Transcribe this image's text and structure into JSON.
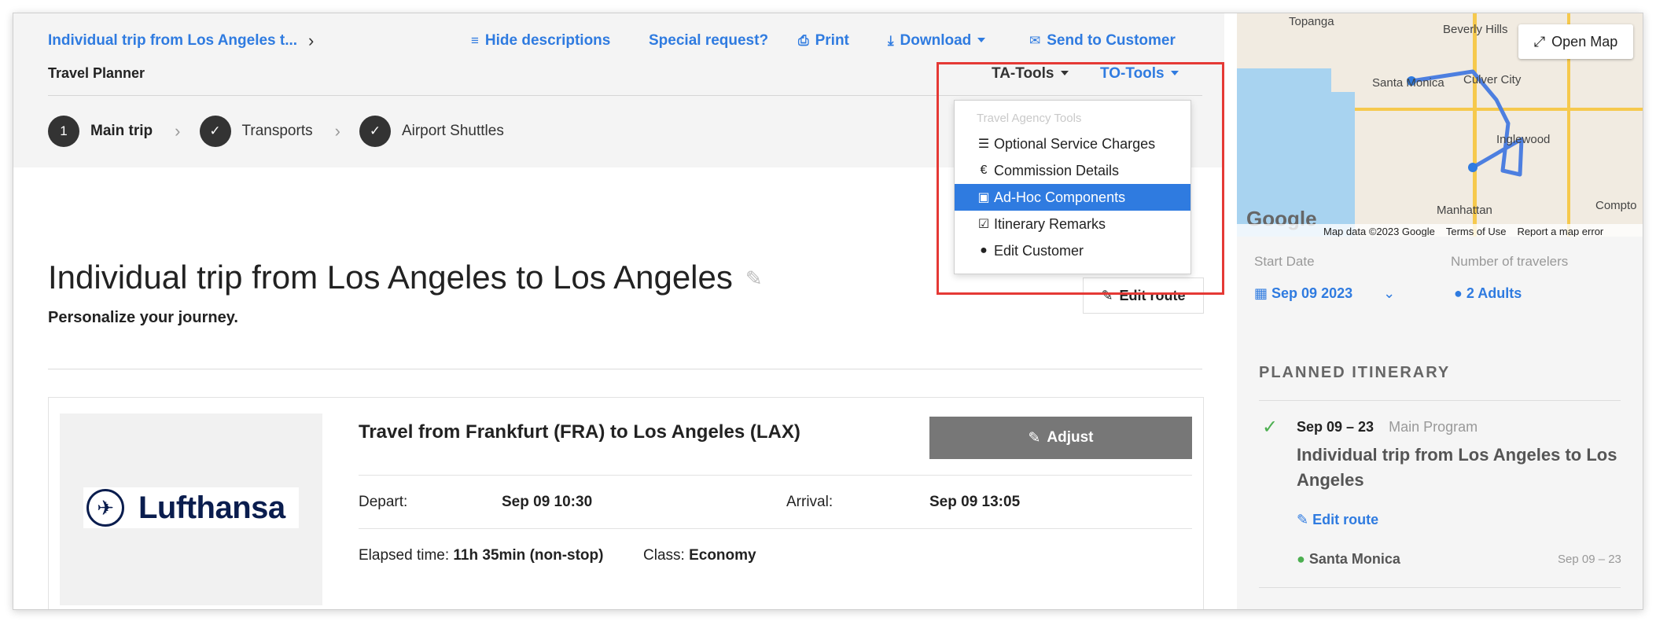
{
  "header": {
    "breadcrumb": "Individual trip from Los Angeles t...",
    "section": "Travel Planner",
    "actions": {
      "hide_descriptions": "Hide descriptions",
      "special_request": "Special request?",
      "print": "Print",
      "download": "Download",
      "send_to_customer": "Send to Customer"
    },
    "ta_tools": "TA-Tools",
    "to_tools": "TO-Tools"
  },
  "steps": [
    {
      "number": "1",
      "label": "Main trip"
    },
    {
      "label": "Transports"
    },
    {
      "label": "Airport Shuttles"
    }
  ],
  "dropdown": {
    "heading": "Travel Agency Tools",
    "items": [
      {
        "label": "Optional Service Charges",
        "icon": "list-icon"
      },
      {
        "label": "Commission Details",
        "icon": "euro-icon"
      },
      {
        "label": "Ad-Hoc Components",
        "icon": "briefcase-icon"
      },
      {
        "label": "Itinerary Remarks",
        "icon": "edit-box-icon"
      },
      {
        "label": "Edit Customer",
        "icon": "user-icon"
      }
    ],
    "active_index": 2
  },
  "trip": {
    "title": "Individual trip from Los Angeles to Los Angeles",
    "subtitle": "Personalize your journey.",
    "edit_route": "Edit route"
  },
  "flight": {
    "logo_text": "Lufthansa",
    "title": "Travel from Frankfurt (FRA) to Los Angeles (LAX)",
    "adjust": "Adjust",
    "depart_label": "Depart:",
    "depart_value": "Sep 09 10:30",
    "arrival_label": "Arrival:",
    "arrival_value": "Sep 09 13:05",
    "elapsed_label": "Elapsed time:",
    "elapsed_value": "11h 35min (non-stop)",
    "class_label": "Class:",
    "class_value": "Economy"
  },
  "map": {
    "open_map": "Open Map",
    "labels": [
      "Topanga",
      "Beverly Hills",
      "Santa Monica",
      "Culver City",
      "Inglewood",
      "Manhattan",
      "Compto"
    ],
    "google": "Google",
    "attribution": [
      "Map data ©2023 Google",
      "Terms of Use",
      "Report a map error"
    ]
  },
  "sidebar": {
    "start_date_label": "Start Date",
    "start_date": "Sep 09 2023",
    "travelers_label": "Number of travelers",
    "travelers": "2 Adults",
    "planned_itinerary": "PLANNED ITINERARY",
    "itinerary": {
      "dates": "Sep 09 – 23",
      "program": "Main Program",
      "title": "Individual trip from Los Angeles to Los Angeles",
      "edit_route": "Edit route",
      "stop": "Santa Monica",
      "stop_dates": "Sep 09 – 23"
    }
  },
  "colors": {
    "accent": "#2f7be0",
    "highlight": "#e53935",
    "success": "#4caf50"
  }
}
